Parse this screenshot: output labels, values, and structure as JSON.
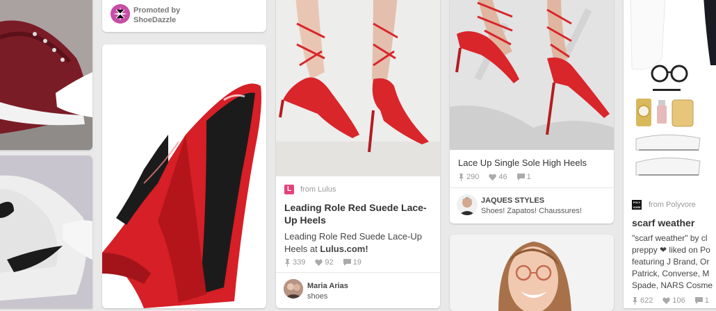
{
  "promoted": {
    "line1": "Promoted by",
    "line2": "ShoeDazzle"
  },
  "lulus_pin": {
    "source": "from Lulus",
    "title": "Leading Role Red Suede Lace-Up Heels",
    "description_part1": "Leading Role Red Suede Lace-Up Heels at ",
    "description_link": "Lulus.com!",
    "repins": "339",
    "likes": "92",
    "comments": "19",
    "pinner_name": "Maria Arias",
    "board": "shoes"
  },
  "jaques_pin": {
    "title": "Lace Up Single Sole High Heels",
    "repins": "290",
    "likes": "46",
    "comments": "1",
    "pinner_name": "JAQUES STYLES",
    "board": "Shoes! Zapatos! Chaussures!"
  },
  "polyvore_pin": {
    "source": "from Polyvore",
    "title": "scarf weather",
    "line1": "\"scarf weather\" by cl",
    "line2": "preppy ❤ liked on Po",
    "line3": "featuring J Brand, Or",
    "line4": "Patrick, Converse, M",
    "line5": "Spade, NARS Cosme",
    "repins": "622",
    "likes": "106",
    "comments": "1",
    "logo_text": "POLY VORE"
  },
  "colors": {
    "red": "#d8262b",
    "link": "#333333",
    "muted": "#999999",
    "lulus_pink": "#e5427b"
  }
}
